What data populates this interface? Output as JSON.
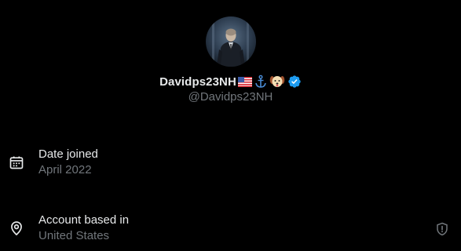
{
  "profile": {
    "display_name": "Davidps23NH",
    "name_emojis": [
      "us-flag-emoji",
      "anchor-emoji",
      "dog-face-emoji"
    ],
    "verified": true,
    "handle": "@Davidps23NH",
    "avatar_icon": "avatar-photo"
  },
  "details": {
    "date_joined": {
      "label": "Date joined",
      "value": "April 2022",
      "icon": "calendar-icon"
    },
    "account_based": {
      "label": "Account based in",
      "value": "United States",
      "icon": "location-pin-icon",
      "action_icon": "shield-alert-icon"
    }
  },
  "colors": {
    "background": "#000000",
    "primary_text": "#e7e9ea",
    "secondary_text": "#71767b",
    "verified_blue": "#1d9bf0"
  }
}
